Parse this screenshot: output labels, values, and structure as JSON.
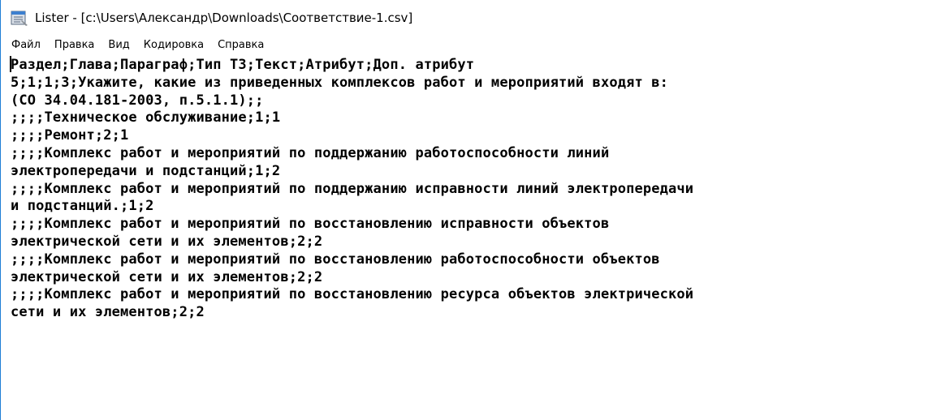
{
  "window": {
    "title": "Lister - [c:\\Users\\Александр\\Downloads\\Соответствие-1.csv]",
    "icon": "lister-app-icon"
  },
  "menu": [
    {
      "label": "Файл"
    },
    {
      "label": "Правка"
    },
    {
      "label": "Вид"
    },
    {
      "label": "Кодировка"
    },
    {
      "label": "Справка"
    }
  ],
  "content": {
    "lines": [
      "Раздел;Глава;Параграф;Тип ТЗ;Текст;Атрибут;Доп. атрибут",
      "5;1;1;3;Укажите, какие из приведенных комплексов работ и мероприятий входят в:",
      "(СО 34.04.181-2003, п.5.1.1);;",
      ";;;;Техническое обслуживание;1;1",
      ";;;;Ремонт;2;1",
      ";;;;Комплекс работ и мероприятий по поддержанию работоспособности линий",
      "электропередачи и подстанций;1;2",
      ";;;;Комплекс работ и мероприятий по поддержанию исправности линий электропередачи",
      "и подстанций.;1;2",
      ";;;;Комплекс работ и мероприятий по восстановлению исправности объектов",
      "электрической сети и их элементов;2;2",
      ";;;;Комплекс работ и мероприятий по восстановлению работоспособности объектов",
      "электрической сети и их элементов;2;2",
      ";;;;Комплекс работ и мероприятий по восстановлению ресурса объектов электрической",
      "сети и их элементов;2;2"
    ]
  }
}
